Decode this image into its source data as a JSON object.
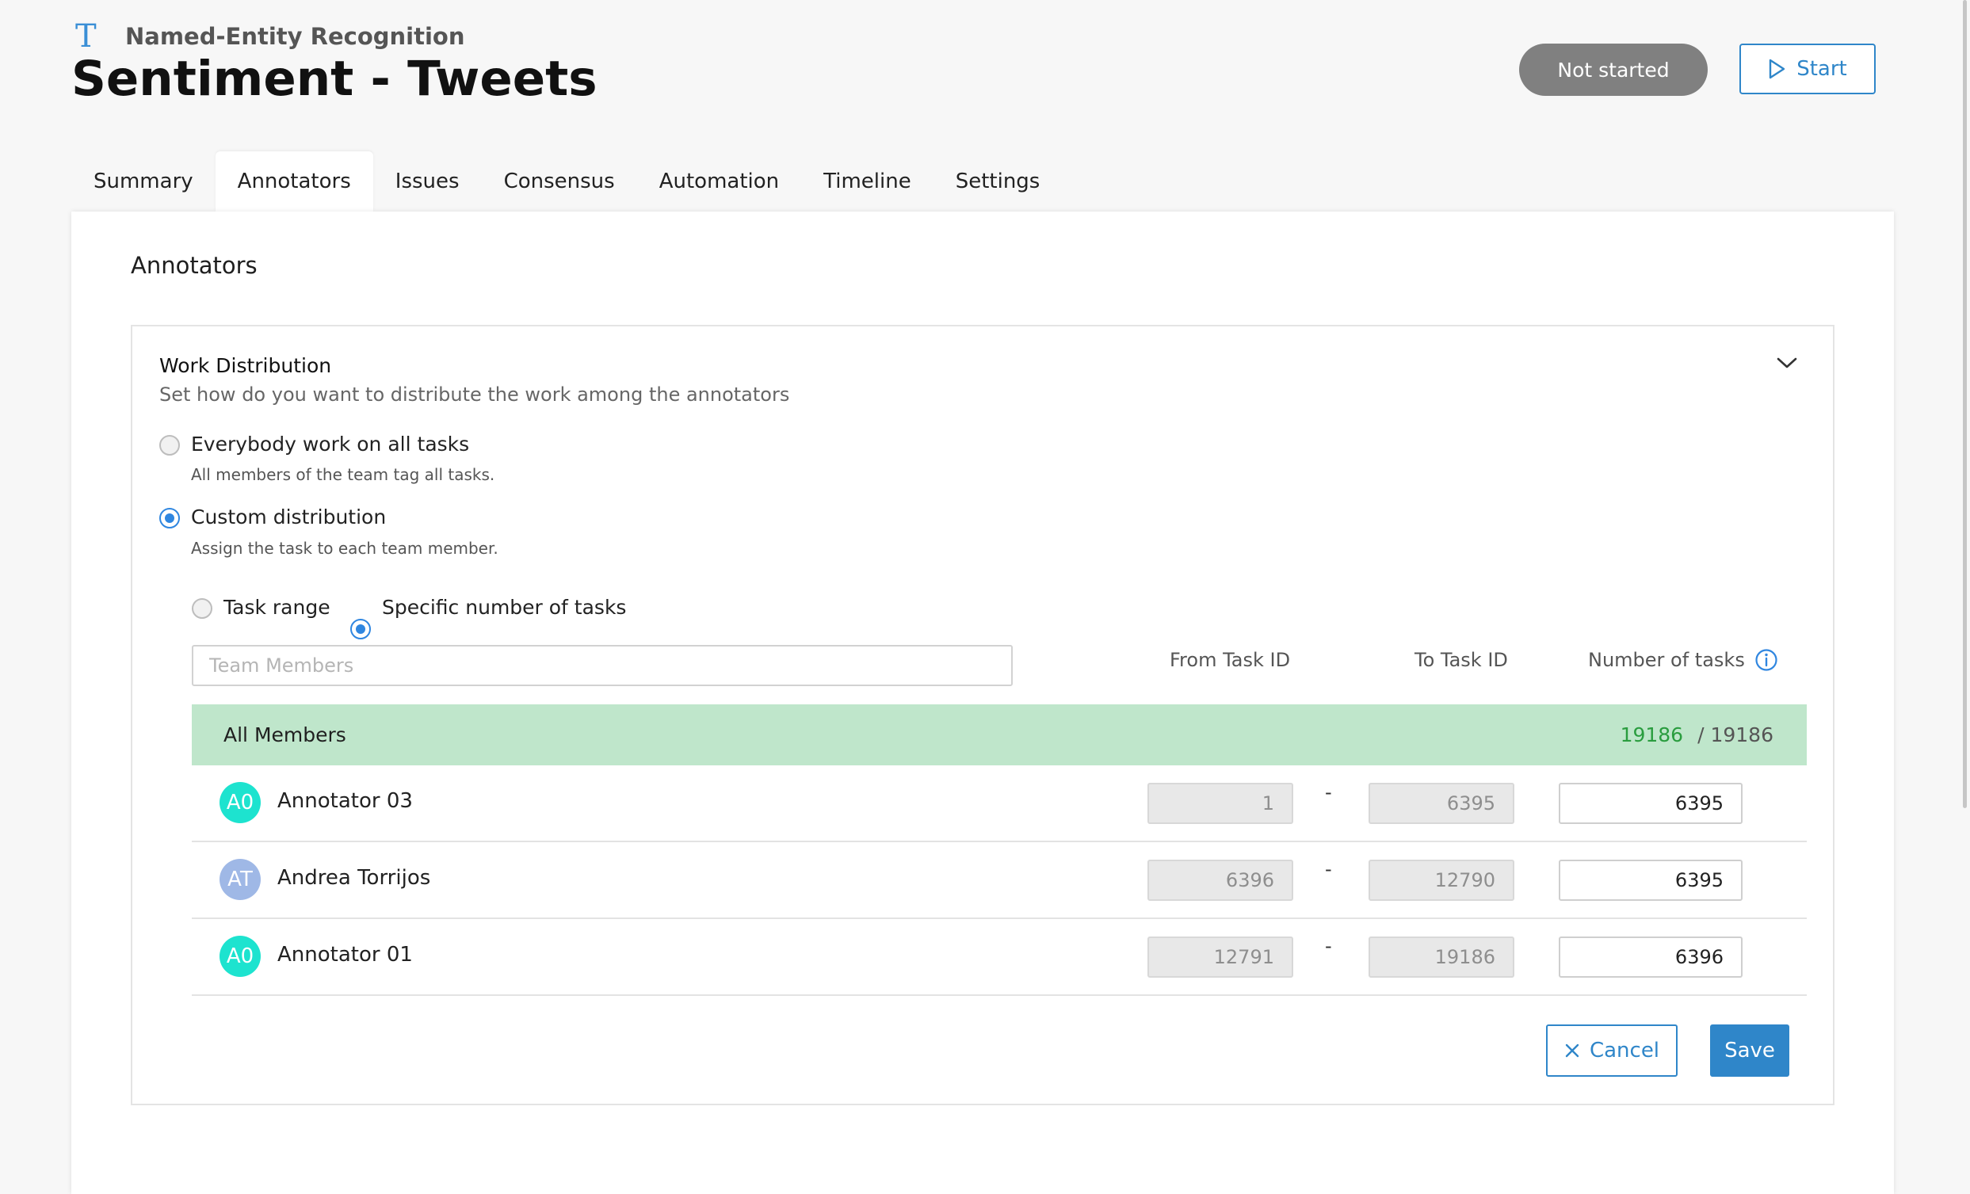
{
  "header": {
    "project_type": "Named-Entity Recognition",
    "project_type_icon": "T",
    "title": "Sentiment - Tweets",
    "status": "Not started",
    "start_label": "Start"
  },
  "tabs": [
    {
      "label": "Summary",
      "active": false
    },
    {
      "label": "Annotators",
      "active": true
    },
    {
      "label": "Issues",
      "active": false
    },
    {
      "label": "Consensus",
      "active": false
    },
    {
      "label": "Automation",
      "active": false
    },
    {
      "label": "Timeline",
      "active": false
    },
    {
      "label": "Settings",
      "active": false
    }
  ],
  "section_title": "Annotators",
  "work_distribution": {
    "title": "Work Distribution",
    "subtitle": "Set how do you want to distribute the work among the annotators",
    "options": [
      {
        "label": "Everybody work on all tasks",
        "description": "All members of the team tag all tasks.",
        "checked": false
      },
      {
        "label": "Custom distribution",
        "description": "Assign the task to each team member.",
        "checked": true
      }
    ],
    "sub_options": [
      {
        "label": "Task range",
        "checked": false
      },
      {
        "label": "Specific number of tasks",
        "checked": true
      }
    ],
    "search_placeholder": "Team Members",
    "columns": {
      "from": "From Task ID",
      "to": "To Task ID",
      "count": "Number of tasks"
    },
    "all_members": {
      "label": "All Members",
      "assigned": "19186",
      "total": "/ 19186"
    },
    "members": [
      {
        "initials": "A0",
        "name": "Annotator 03",
        "from": "1",
        "to": "6395",
        "count": "6395",
        "avatar_color": "#1de3cf"
      },
      {
        "initials": "AT",
        "name": "Andrea Torrijos",
        "from": "6396",
        "to": "12790",
        "count": "6395",
        "avatar_color": "#9fb8e6"
      },
      {
        "initials": "A0",
        "name": "Annotator 01",
        "from": "12791",
        "to": "19186",
        "count": "6396",
        "avatar_color": "#1de3cf"
      }
    ],
    "range_separator": "-",
    "cancel_label": "Cancel",
    "save_label": "Save"
  },
  "colors": {
    "accent": "#2f86c9",
    "all_members_bg": "#bfe6cb",
    "assigned_green": "#2a9d3f",
    "status_pill": "#808080"
  }
}
